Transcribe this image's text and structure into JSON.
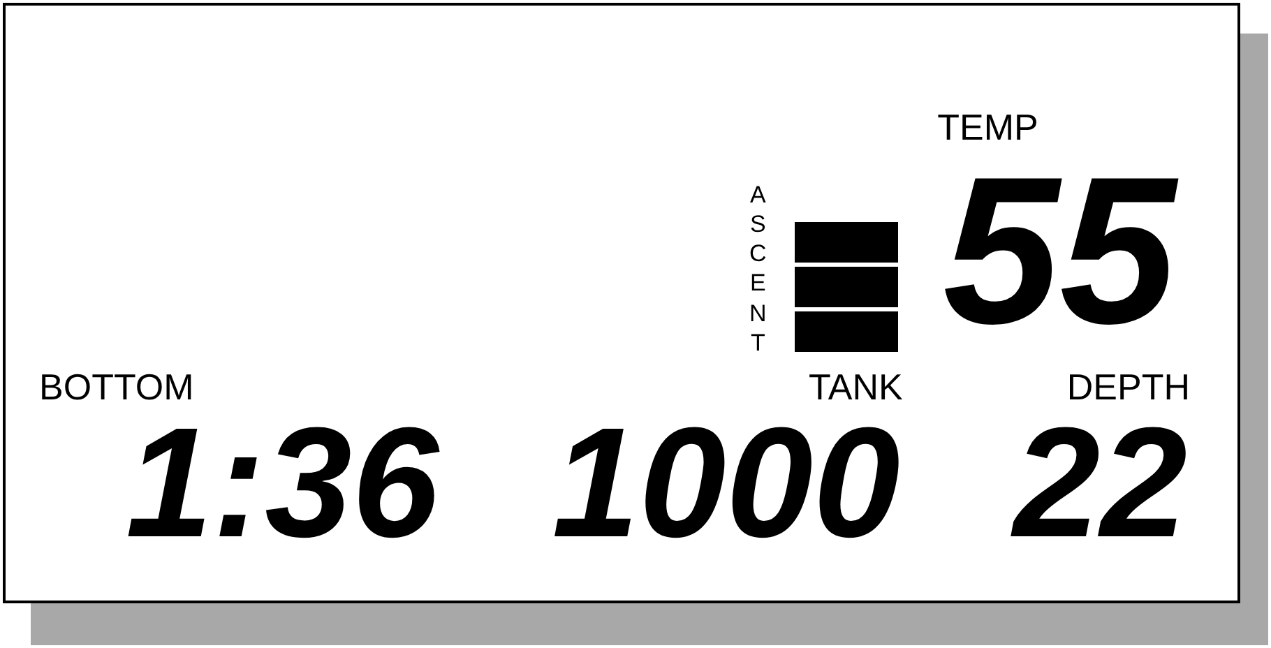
{
  "temp": {
    "label": "TEMP",
    "value": "55"
  },
  "ascent": {
    "label": "ASCENT",
    "segments": [
      {
        "lit": true
      },
      {
        "lit": true
      },
      {
        "lit": true
      }
    ]
  },
  "readouts": [
    {
      "label": "BOTTOM",
      "value": "1:36"
    },
    {
      "label": "TANK",
      "value": "1000"
    },
    {
      "label": "DEPTH",
      "value": "22"
    }
  ]
}
